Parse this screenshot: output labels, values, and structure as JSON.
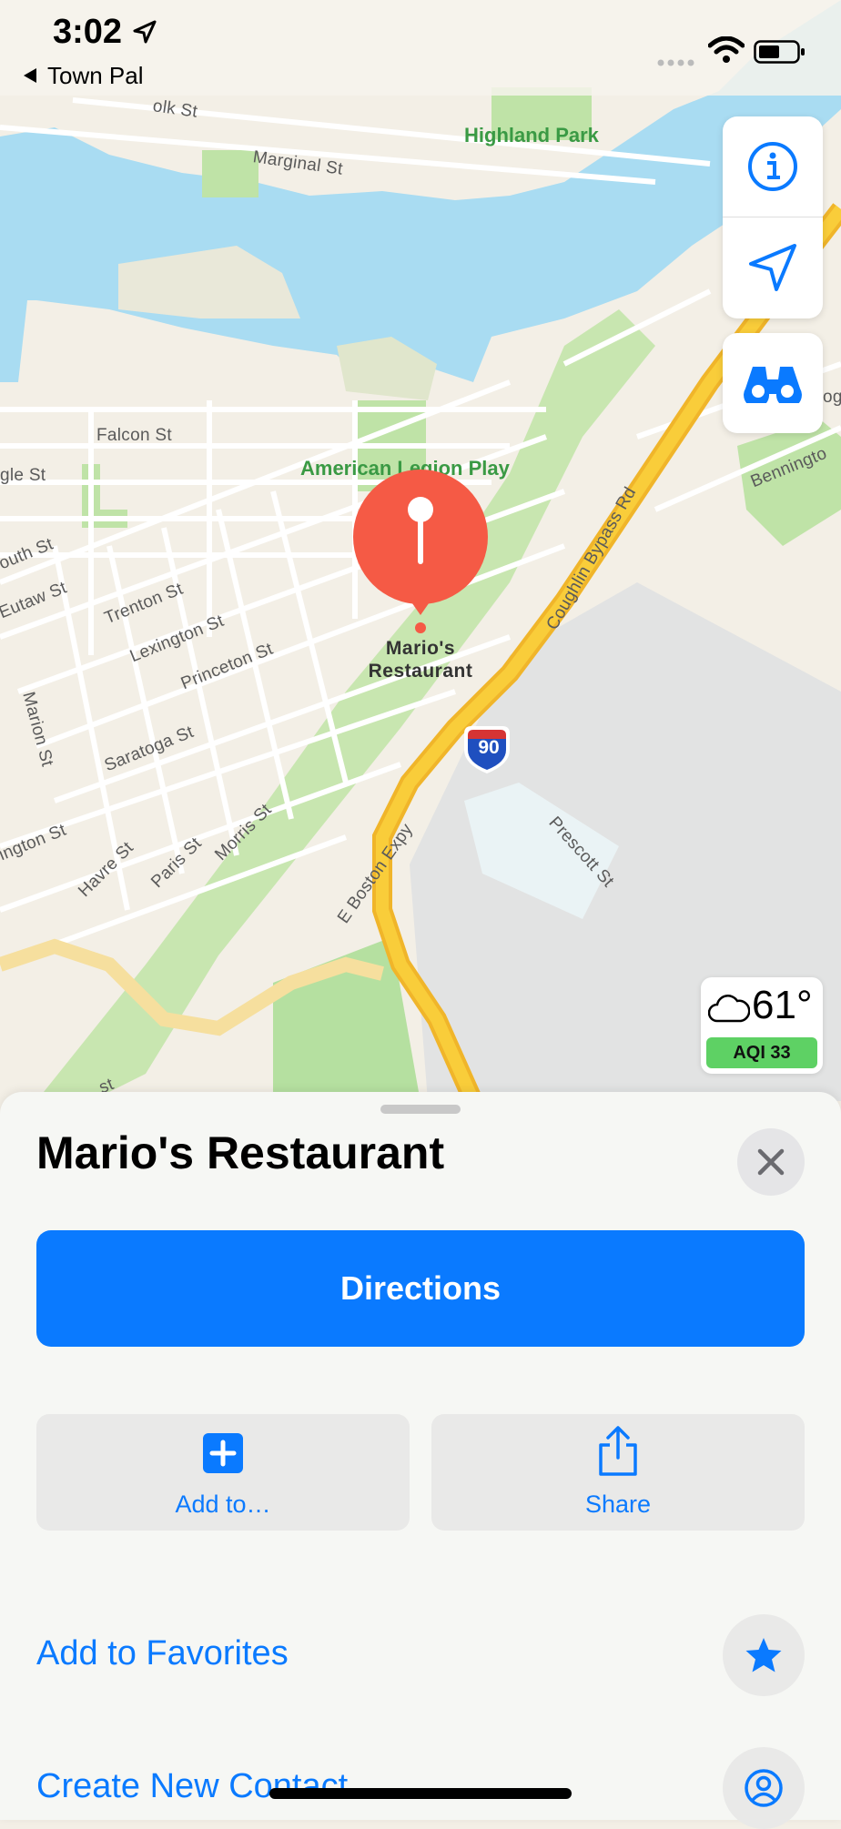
{
  "status_bar": {
    "time": "3:02",
    "back_app": "Town Pal"
  },
  "map": {
    "park_labels": [
      "Highland Park",
      "American Legion Play"
    ],
    "street_labels": [
      "Marginal St",
      "Falcon St",
      "gle St",
      "outh St",
      "Eutaw St",
      "Trenton St",
      "Lexington St",
      "Princeton St",
      "Marion St",
      "Saratoga St",
      "ington St",
      "Havre St",
      "Paris St",
      "Morris St",
      "E Boston Expy",
      "Coughlin Bypass Rd",
      "Prescott St",
      "Benningto",
      "olk St",
      "og",
      "st"
    ],
    "highway_shield": "90",
    "pin_label_line1": "Mario's",
    "pin_label_line2": "Restaurant",
    "colors": {
      "land": "#f3efe6",
      "water": "#a9dcf2",
      "park": "#bfe3a7",
      "highway": "#f9cd3a",
      "pin": "#f55a45",
      "accent": "#0a7aff"
    }
  },
  "weather": {
    "temperature": "61°",
    "aqi": "AQI 33"
  },
  "sheet": {
    "title": "Mario's Restaurant",
    "directions_label": "Directions",
    "add_to_label": "Add to…",
    "share_label": "Share",
    "favorites_label": "Add to Favorites",
    "contact_label": "Create New Contact"
  }
}
